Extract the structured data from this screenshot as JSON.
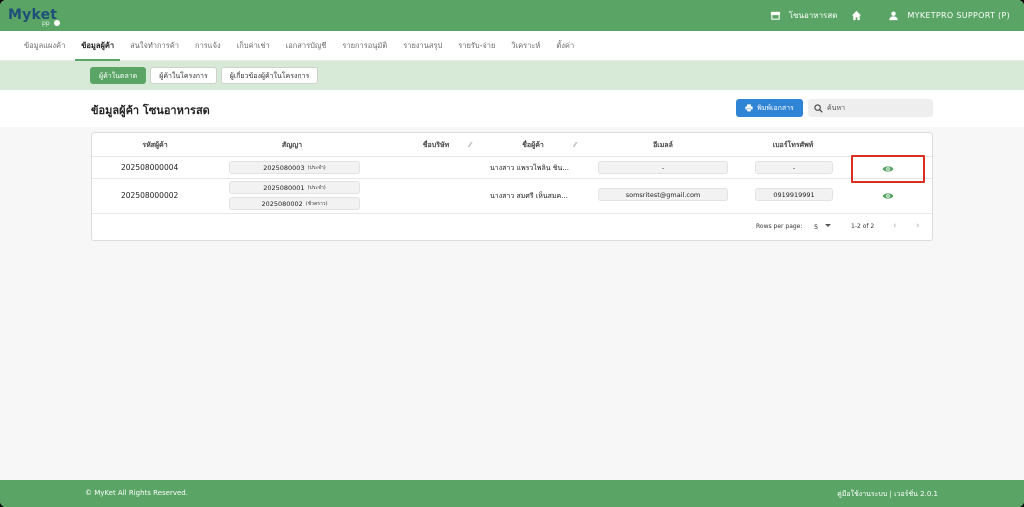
{
  "app": {
    "logo_main": "Myket",
    "logo_sub": "pp",
    "store_name": "โซนอาหารสด",
    "user_name": "MYKETPRO SUPPORT (P)"
  },
  "menu": {
    "items": [
      {
        "label": "ข้อมูลแผงค้า"
      },
      {
        "label": "ข้อมูลผู้ค้า"
      },
      {
        "label": "สนใจทำการค้า"
      },
      {
        "label": "การแจ้ง"
      },
      {
        "label": "เก็บค่าเช่า"
      },
      {
        "label": "เอกสารบัญชี"
      },
      {
        "label": "รายการอนุมัติ"
      },
      {
        "label": "รายงานสรุป"
      },
      {
        "label": "รายรับ-จ่าย"
      },
      {
        "label": "วิเคราะห์"
      },
      {
        "label": "ตั้งค่า"
      }
    ],
    "active_index": 1
  },
  "subtabs": [
    {
      "label": "ผู้ค้าในตลาด"
    },
    {
      "label": "ผู้ค้าในโครงการ"
    },
    {
      "label": "ผู้เกี่ยวข้องผู้ค้าในโครงการ"
    }
  ],
  "page": {
    "title": "ข้อมูลผู้ค้า โซนอาหารสด",
    "print_label": "พิมพ์เอกสาร",
    "search_placeholder": "ค้นหา"
  },
  "table": {
    "columns": {
      "id": "รหัสผู้ค้า",
      "contract": "สัญญา",
      "company": "ชื่อบริษัท",
      "name": "ชื่อผู้ค้า",
      "email": "อีเมลล์",
      "phone": "เบอร์โทรศัพท์"
    },
    "rows": [
      {
        "id": "202508000004",
        "contracts": [
          {
            "no": "2025080003",
            "type": "(ประจำ)"
          }
        ],
        "company": "",
        "name": "นางสาว แพรวไพลิน ชิน...",
        "email": "-",
        "phone": "-"
      },
      {
        "id": "202508000002",
        "contracts": [
          {
            "no": "2025080001",
            "type": "(ประจำ)"
          },
          {
            "no": "2025080002",
            "type": "(ชั่วคราว)"
          }
        ],
        "company": "",
        "name": "นางสาว สมศรี เห็นสมค...",
        "email": "somsritest@gmail.com",
        "phone": "0919919991"
      }
    ],
    "pagination": {
      "rows_per_page_label": "Rows per page:",
      "rows_per_page": "5",
      "range": "1-2 of 2"
    }
  },
  "footer": {
    "copyright": "© MyKet All Rights Reserved.",
    "manual": "คู่มือใช้งานระบบ | เวอร์ชั่น 2.0.1"
  },
  "colors": {
    "brand_green": "#5aa565",
    "light_green": "#d6ead7",
    "print_blue": "#2f84d6",
    "highlight_red": "#d93025"
  }
}
